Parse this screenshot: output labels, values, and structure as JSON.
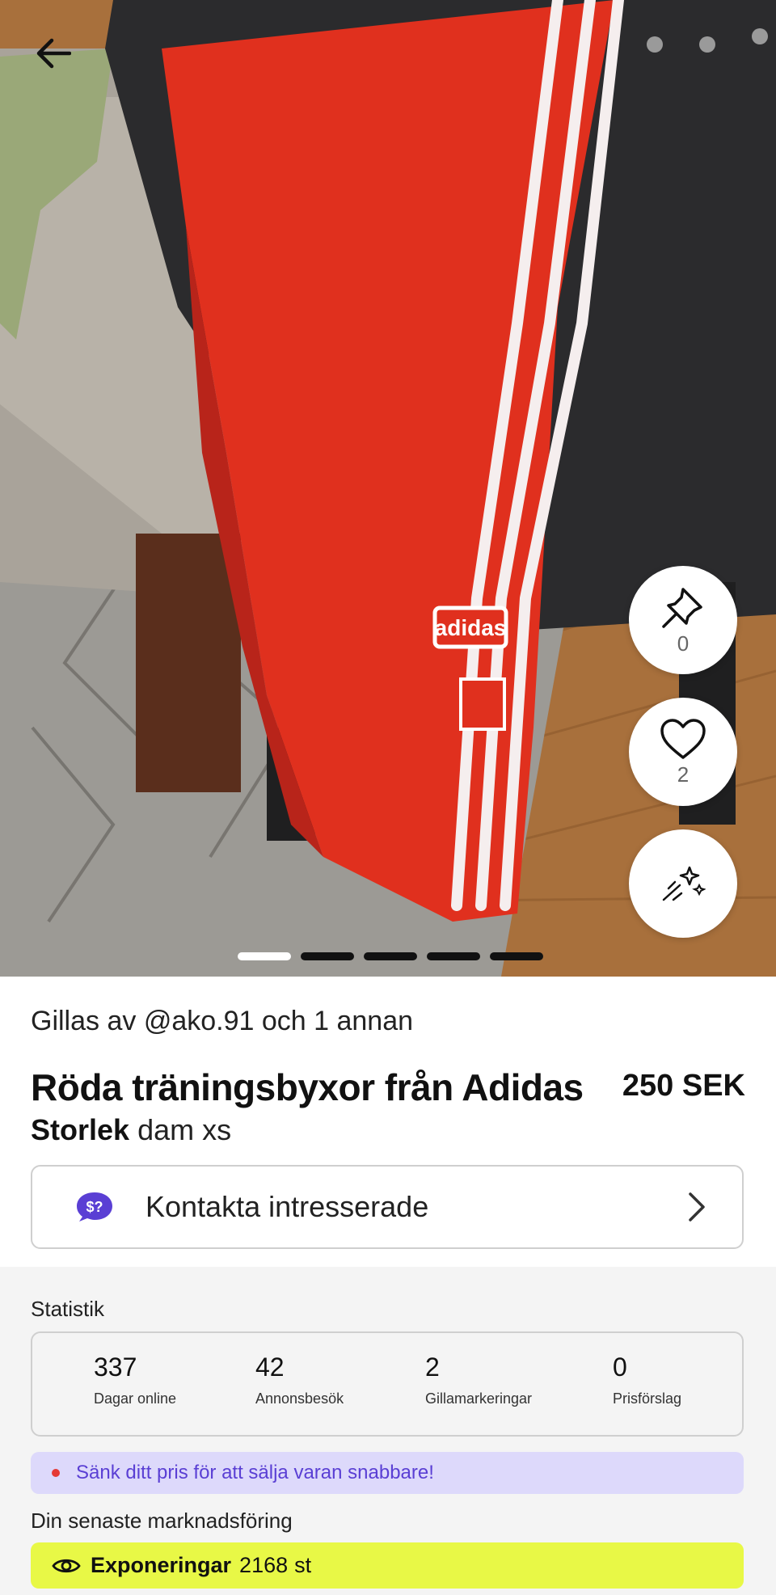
{
  "product": {
    "liked_by": "Gillas av @ako.91 och 1 annan",
    "title": "Röda träningsbyxor från Adidas",
    "price": "250 SEK",
    "size_label": "Storlek",
    "size_value": "dam xs",
    "image_brand_text": "adidas"
  },
  "actions": {
    "pin_count": "0",
    "like_count": "2"
  },
  "gallery": {
    "image_count": 5,
    "active_index": 0
  },
  "contact": {
    "label": "Kontakta intresserade",
    "icon_text": "$?"
  },
  "stats": {
    "title": "Statistik",
    "items": [
      {
        "value": "337",
        "label": "Dagar online"
      },
      {
        "value": "42",
        "label": "Annonsbesök"
      },
      {
        "value": "2",
        "label": "Gillamarkeringar"
      },
      {
        "value": "0",
        "label": "Prisförslag"
      }
    ]
  },
  "tip": {
    "text": "Sänk ditt pris för att sälja varan snabbare!"
  },
  "marketing": {
    "title": "Din senaste marknadsföring",
    "exposure_label": "Exponeringar",
    "exposure_value": "2168",
    "exposure_unit": "st"
  },
  "colors": {
    "accent_purple": "#5a3fd4",
    "tip_bg": "#ddd9fb",
    "exposure_bg": "#e8f846",
    "pants_red": "#e0301e"
  },
  "icons": {
    "back": "arrow-left-icon",
    "pin": "pin-icon",
    "like": "heart-icon",
    "magic": "sparkle-wand-icon",
    "contact": "price-question-chat-icon",
    "chevron": "chevron-right-icon",
    "eye": "eye-icon"
  }
}
